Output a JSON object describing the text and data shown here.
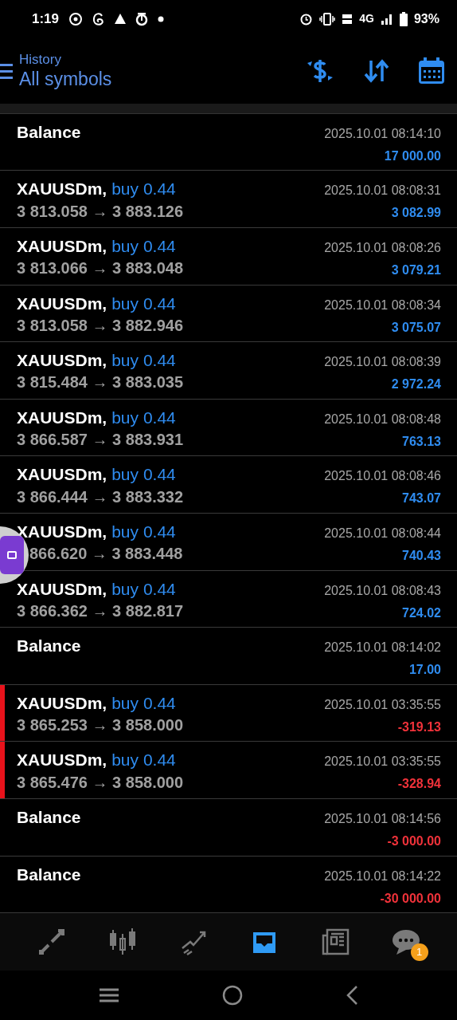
{
  "status_bar": {
    "time": "1:19",
    "battery": "93%",
    "network": "4G"
  },
  "header": {
    "subtitle": "History",
    "title": "All symbols"
  },
  "rows": [
    {
      "kind": "balance",
      "symbol": "Balance",
      "time": "2025.10.01 08:14:10",
      "profit": "17 000.00",
      "negative": false,
      "floating_button": false
    },
    {
      "kind": "trade",
      "symbol": "XAUUSDm,",
      "side": "buy 0.44",
      "prices": "3 813.058 → 3 883.126",
      "time": "2025.10.01 08:08:31",
      "profit": "3 082.99",
      "negative": false,
      "floating_button": false
    },
    {
      "kind": "trade",
      "symbol": "XAUUSDm,",
      "side": "buy 0.44",
      "prices": "3 813.066 → 3 883.048",
      "time": "2025.10.01 08:08:26",
      "profit": "3 079.21",
      "negative": false,
      "floating_button": false
    },
    {
      "kind": "trade",
      "symbol": "XAUUSDm,",
      "side": "buy 0.44",
      "prices": "3 813.058 → 3 882.946",
      "time": "2025.10.01 08:08:34",
      "profit": "3 075.07",
      "negative": false,
      "floating_button": false
    },
    {
      "kind": "trade",
      "symbol": "XAUUSDm,",
      "side": "buy 0.44",
      "prices": "3 815.484 → 3 883.035",
      "time": "2025.10.01 08:08:39",
      "profit": "2 972.24",
      "negative": false,
      "floating_button": false
    },
    {
      "kind": "trade",
      "symbol": "XAUUSDm,",
      "side": "buy 0.44",
      "prices": "3 866.587 → 3 883.931",
      "time": "2025.10.01 08:08:48",
      "profit": "763.13",
      "negative": false,
      "floating_button": false
    },
    {
      "kind": "trade",
      "symbol": "XAUUSDm,",
      "side": "buy 0.44",
      "prices": "3 866.444 → 3 883.332",
      "time": "2025.10.01 08:08:46",
      "profit": "743.07",
      "negative": false,
      "floating_button": false
    },
    {
      "kind": "trade",
      "symbol": "XAUUSDm,",
      "side": "buy 0.44",
      "prices": "866.620 → 3 883.448",
      "time": "2025.10.01 08:08:44",
      "profit": "740.43",
      "negative": false,
      "floating_button": true
    },
    {
      "kind": "trade",
      "symbol": "XAUUSDm,",
      "side": "buy 0.44",
      "prices": "3 866.362 → 3 882.817",
      "time": "2025.10.01 08:08:43",
      "profit": "724.02",
      "negative": false,
      "floating_button": false
    },
    {
      "kind": "balance",
      "symbol": "Balance",
      "time": "2025.10.01 08:14:02",
      "profit": "17.00",
      "negative": false,
      "floating_button": false
    },
    {
      "kind": "trade",
      "symbol": "XAUUSDm,",
      "side": "buy 0.44",
      "prices": "3 865.253 → 3 858.000",
      "time": "2025.10.01 03:35:55",
      "profit": "-319.13",
      "negative": true,
      "floating_button": false
    },
    {
      "kind": "trade",
      "symbol": "XAUUSDm,",
      "side": "buy 0.44",
      "prices": "3 865.476 → 3 858.000",
      "time": "2025.10.01 03:35:55",
      "profit": "-328.94",
      "negative": true,
      "floating_button": false
    },
    {
      "kind": "balance",
      "symbol": "Balance",
      "time": "2025.10.01 08:14:56",
      "profit": "-3 000.00",
      "negative": true,
      "floating_button": false
    },
    {
      "kind": "balance",
      "symbol": "Balance",
      "time": "2025.10.01 08:14:22",
      "profit": "-30 000.00",
      "negative": true,
      "floating_button": false
    }
  ],
  "nav": [
    {
      "kind": "trade",
      "selected": false
    },
    {
      "kind": "quotes",
      "selected": false
    },
    {
      "kind": "chart",
      "selected": false
    },
    {
      "kind": "history",
      "selected": true
    },
    {
      "kind": "news",
      "selected": false
    },
    {
      "kind": "chat",
      "selected": false,
      "badge": "1"
    }
  ]
}
